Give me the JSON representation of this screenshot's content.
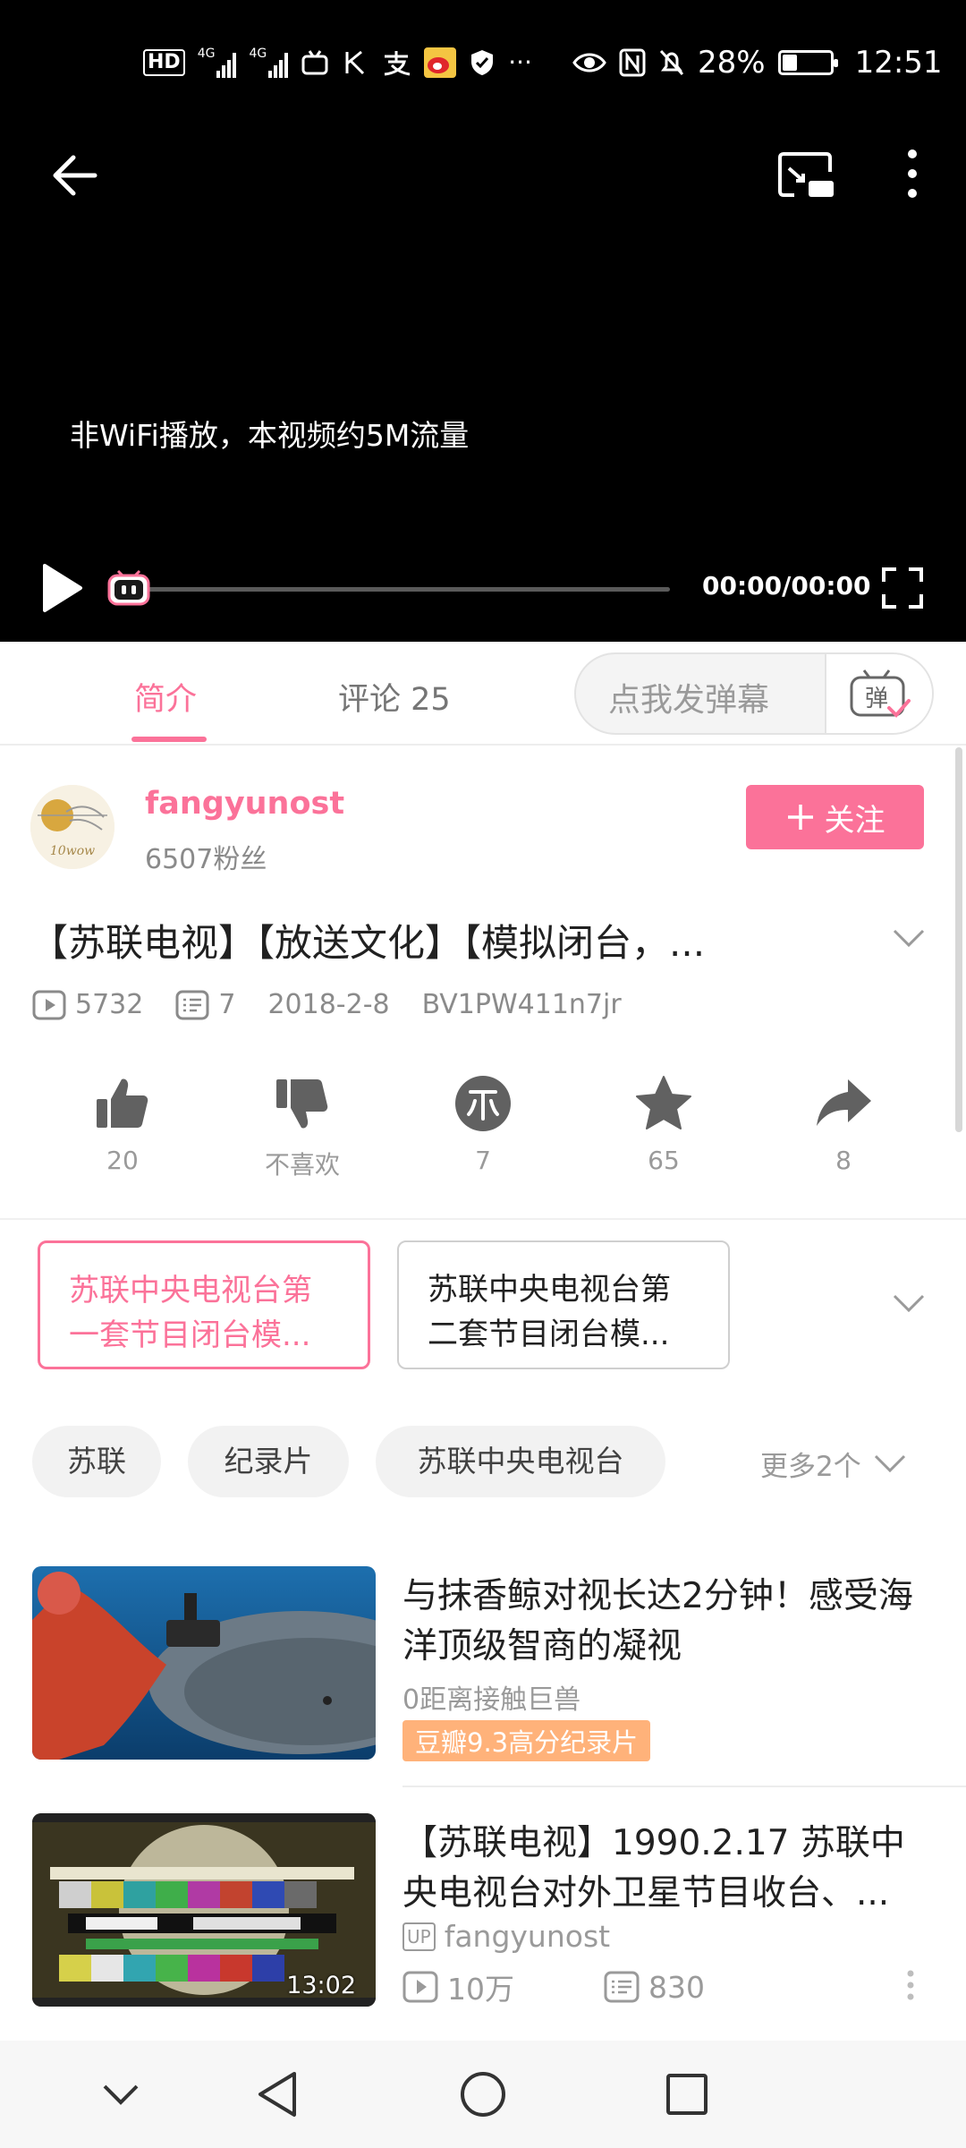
{
  "status_bar": {
    "hd_label": "HD",
    "net1": "4G",
    "net2": "4G",
    "battery_pct": "28%",
    "time": "12:51",
    "icons": [
      "hd-icon",
      "signal-icon",
      "signal-icon",
      "bilibili-icon",
      "k-icon",
      "alipay-icon",
      "weibo-icon",
      "shield-icon",
      "more-dots-icon",
      "eye-icon",
      "nfc-icon",
      "mute-bell-icon",
      "battery-icon"
    ]
  },
  "player": {
    "notice": "非WiFi播放，本视频约5M流量",
    "time": "00:00/00:00",
    "progress": 0,
    "icons": [
      "back-arrow-icon",
      "cast-icon",
      "more-vertical-icon",
      "play-icon",
      "tv-mascot-icon",
      "fullscreen-icon"
    ]
  },
  "tabs": {
    "intro": "简介",
    "comments": "评论 25",
    "danmu_placeholder": "点我发弹幕",
    "danmu_button_glyph": "弹"
  },
  "uploader": {
    "name": "fangyunost",
    "fans": "6507粉丝",
    "follow_label": "关注",
    "avatar_text": "10wow"
  },
  "video": {
    "title": "【苏联电视】【放送文化】【模拟闭台，...",
    "views": "5732",
    "danmaku": "7",
    "date": "2018-2-8",
    "bvid": "BV1PW411n7jr"
  },
  "actions": [
    {
      "name": "like",
      "label": "20"
    },
    {
      "name": "dislike",
      "label": "不喜欢"
    },
    {
      "name": "coin",
      "label": "7"
    },
    {
      "name": "favorite",
      "label": "65"
    },
    {
      "name": "share",
      "label": "8"
    }
  ],
  "episodes": [
    {
      "line1": "苏联中央电视台第",
      "line2": "一套节目闭台模...",
      "active": true
    },
    {
      "line1": "苏联中央电视台第",
      "line2": "二套节目闭台模...",
      "active": false
    }
  ],
  "tags": [
    "苏联",
    "纪录片",
    "苏联中央电视台"
  ],
  "tags_more": "更多2个",
  "related": [
    {
      "title": "与抹香鲸对视长达2分钟！感受海洋顶级智商的凝视",
      "subtitle": "0距离接触巨兽",
      "badge": "豆瓣9.3高分纪录片"
    },
    {
      "title": "【苏联电视】1990.2.17 苏联中央电视台对外卫星节目收台、...",
      "uploader": "fangyunost",
      "views": "10万",
      "danmaku": "830",
      "duration": "13:02",
      "up_tag": "UP"
    }
  ],
  "colors": {
    "accent": "#fb7299",
    "badge": "#ffb27a",
    "muted": "#9a9a9a"
  }
}
